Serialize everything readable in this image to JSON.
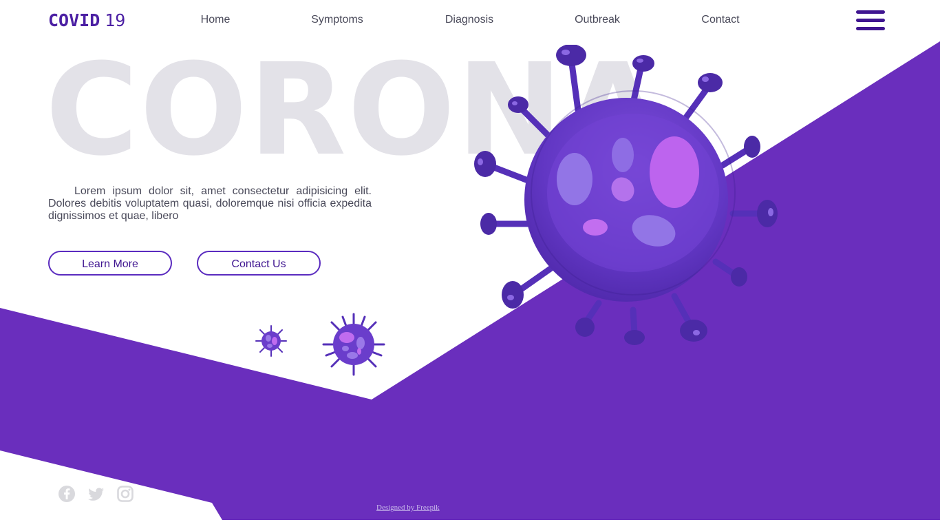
{
  "brand": {
    "name": "COVID",
    "number": "19",
    "accent_color": "#4b1fa3",
    "purple_bg": "#6a2ebd"
  },
  "nav": {
    "items": [
      {
        "label": "Home"
      },
      {
        "label": "Symptoms"
      },
      {
        "label": "Diagnosis"
      },
      {
        "label": "Outbreak"
      },
      {
        "label": "Contact"
      }
    ],
    "menu_icon": "hamburger-menu-icon"
  },
  "hero": {
    "big_word": "CORONA",
    "paragraph": "Lorem ipsum dolor sit, amet consectetur adipisicing elit. Dolores debitis voluptatem quasi, doloremque nisi officia expedita dignissimos et quae, libero",
    "learn_more": "Learn More",
    "contact_us": "Contact Us"
  },
  "social": [
    {
      "icon": "facebook-icon"
    },
    {
      "icon": "twitter-icon"
    },
    {
      "icon": "instagram-icon"
    }
  ],
  "footer": {
    "credit": "Designed by Freepik"
  }
}
